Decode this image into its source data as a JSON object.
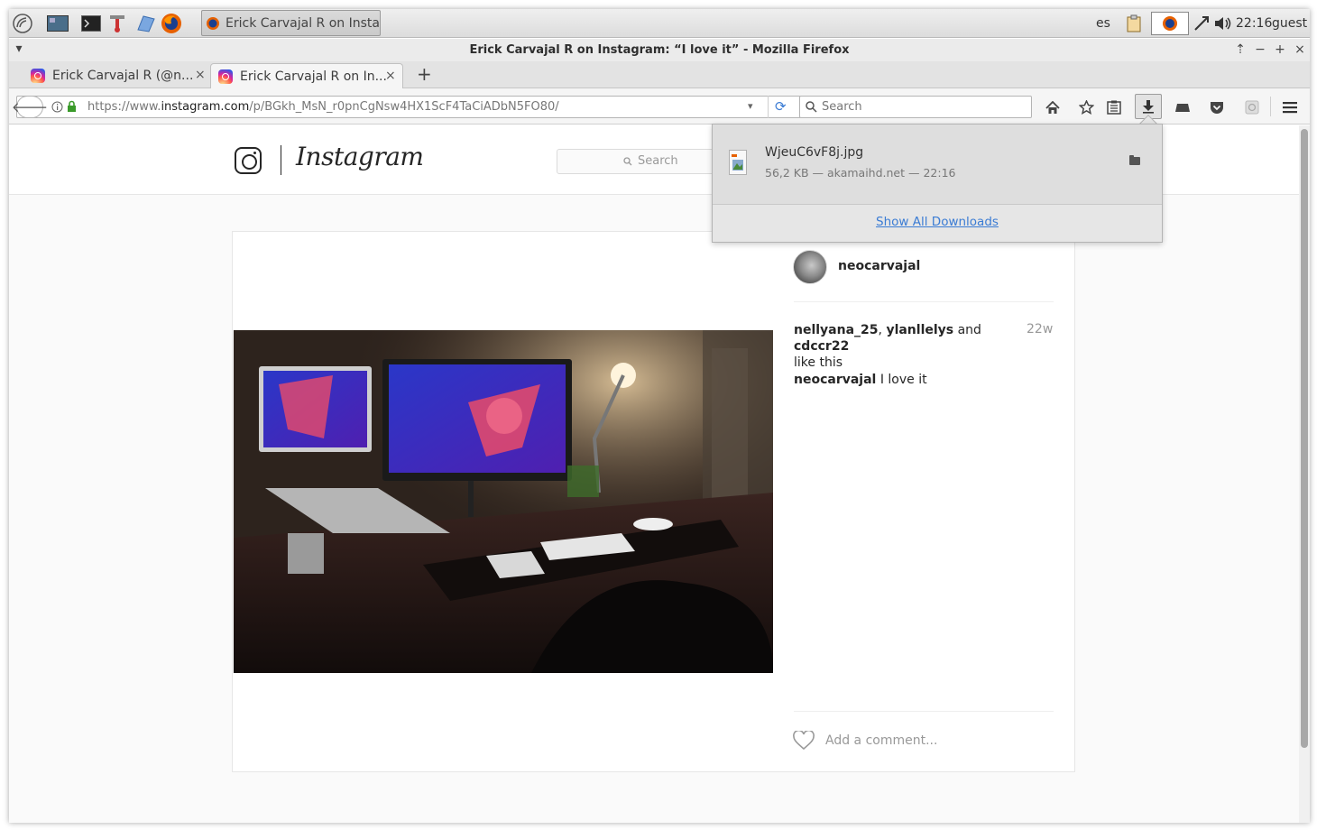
{
  "panel": {
    "launchers": [
      "app-menu-icon",
      "desktop-icon",
      "terminal-icon",
      "tools-icon",
      "files-icon",
      "firefox-icon"
    ],
    "task_title": "Erick Carvajal R on Insta...",
    "lang": "es",
    "clock": "22:16",
    "user": "guest"
  },
  "window": {
    "title": "Erick Carvajal R on Instagram: “I love it” - Mozilla Firefox"
  },
  "tabs": [
    {
      "label": "Erick Carvajal R (@n...",
      "active": false
    },
    {
      "label": "Erick Carvajal R on In...",
      "active": true
    }
  ],
  "navbar": {
    "url_prefix": "https://www.",
    "url_domain": "instagram.com",
    "url_path": "/p/BGkh_MsN_r0pnCgNsw4HX1ScF4TaCiADbN5FO80/",
    "search_placeholder": "Search"
  },
  "instagram": {
    "wordmark": "Instagram",
    "search_placeholder": "Search",
    "post": {
      "username": "neocarvajal",
      "liker1": "nellyana_25",
      "sep1": ",",
      "liker2": "ylanllelys",
      "and": "and",
      "liker3": "cdccr22",
      "like_suffix": "like this",
      "age": "22w",
      "caption_user": "neocarvajal",
      "caption_text": "I love it",
      "comment_placeholder": "Add a comment..."
    }
  },
  "downloads": {
    "file_name": "WjeuC6vF8j.jpg",
    "file_meta": "56,2 KB — akamaihd.net — 22:16",
    "show_all": "Show All Downloads"
  }
}
